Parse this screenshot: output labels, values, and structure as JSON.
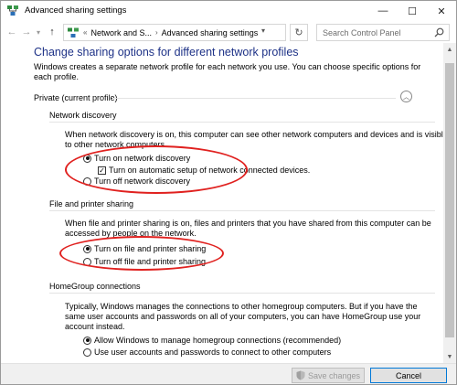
{
  "window": {
    "title": "Advanced sharing settings"
  },
  "window_controls": {
    "minimize": "—",
    "maximize": "☐",
    "close": "✕"
  },
  "nav": {
    "back": "←",
    "forward": "→",
    "up": "↑",
    "refresh": "↻"
  },
  "address": {
    "prefix": "«",
    "crumbs": [
      "Network and S...",
      "Advanced sharing settings"
    ],
    "separator": "›"
  },
  "search": {
    "placeholder": "Search Control Panel"
  },
  "main": {
    "heading": "Change sharing options for different network profiles",
    "intro": "Windows creates a separate network profile for each network you use. You can choose specific options for each profile.",
    "profile_title": "Private (current profile)",
    "network_discovery": {
      "title": "Network discovery",
      "description": "When network discovery is on, this computer can see other network computers and devices and is visible to other network computers.",
      "on_label": "Turn on network discovery",
      "auto_setup_label": "Turn on automatic setup of network connected devices.",
      "off_label": "Turn off network discovery",
      "selected": "on",
      "auto_setup_checked": true
    },
    "file_printer": {
      "title": "File and printer sharing",
      "description": "When file and printer sharing is on, files and printers that you have shared from this computer can be accessed by people on the network.",
      "on_label": "Turn on file and printer sharing",
      "off_label": "Turn off file and printer sharing",
      "selected": "on"
    },
    "homegroup": {
      "title": "HomeGroup connections",
      "description": "Typically, Windows manages the connections to other homegroup computers. But if you have the same user accounts and passwords on all of your computers, you can have HomeGroup use your account instead.",
      "allow_label": "Allow Windows to manage homegroup connections (recommended)",
      "use_accounts_label": "Use user accounts and passwords to connect to other computers",
      "selected": "allow"
    }
  },
  "footer": {
    "save_label": "Save changes",
    "cancel_label": "Cancel"
  },
  "colors": {
    "heading": "#1e3287",
    "highlight": "#e0211f",
    "accent": "#0078d7"
  }
}
